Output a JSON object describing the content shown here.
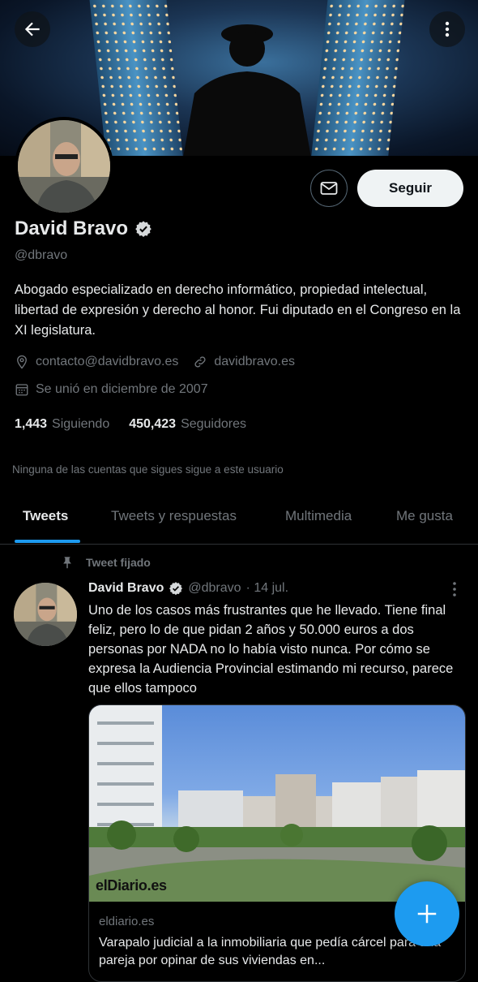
{
  "header": {
    "back_icon": "arrow-left-icon",
    "more_icon": "more-vertical-icon"
  },
  "profile": {
    "name": "David Bravo",
    "handle": "@dbravo",
    "bio": "Abogado especializado en derecho informático, propiedad intelectual, libertad de expresión y derecho al honor. Fui diputado en el Congreso en la XI legislatura.",
    "email": "contacto@davidbravo.es",
    "website": "davidbravo.es",
    "joined": "Se unió en diciembre de 2007",
    "following_count": "1,443",
    "following_label": "Siguiendo",
    "followers_count": "450,423",
    "followers_label": "Seguidores",
    "no_mutual": "Ninguna de las cuentas que sigues sigue a este usuario",
    "follow_label": "Seguir"
  },
  "tabs": [
    {
      "label": "Tweets"
    },
    {
      "label": "Tweets y respuestas"
    },
    {
      "label": "Multimedia"
    },
    {
      "label": "Me gusta"
    }
  ],
  "tweet": {
    "pinned_label": "Tweet fijado",
    "author": "David Bravo",
    "handle": "@dbravo",
    "date": "· 14 jul.",
    "text": "Uno de los casos más frustrantes que he llevado. Tiene final feliz, pero lo de que pidan 2 años y 50.000 euros a dos personas por NADA no lo había visto nunca. Por cómo se expresa la Audiencia Provincial estimando mi recurso, parece que ellos tampoco",
    "card": {
      "logo": "elDiario.es",
      "domain": "eldiario.es",
      "title": "Varapalo judicial a la inmobiliaria que pedía cárcel para una pareja por opinar de sus viviendas en..."
    }
  },
  "colors": {
    "accent": "#1d9bf0",
    "background": "#000000",
    "muted": "#71767b"
  }
}
